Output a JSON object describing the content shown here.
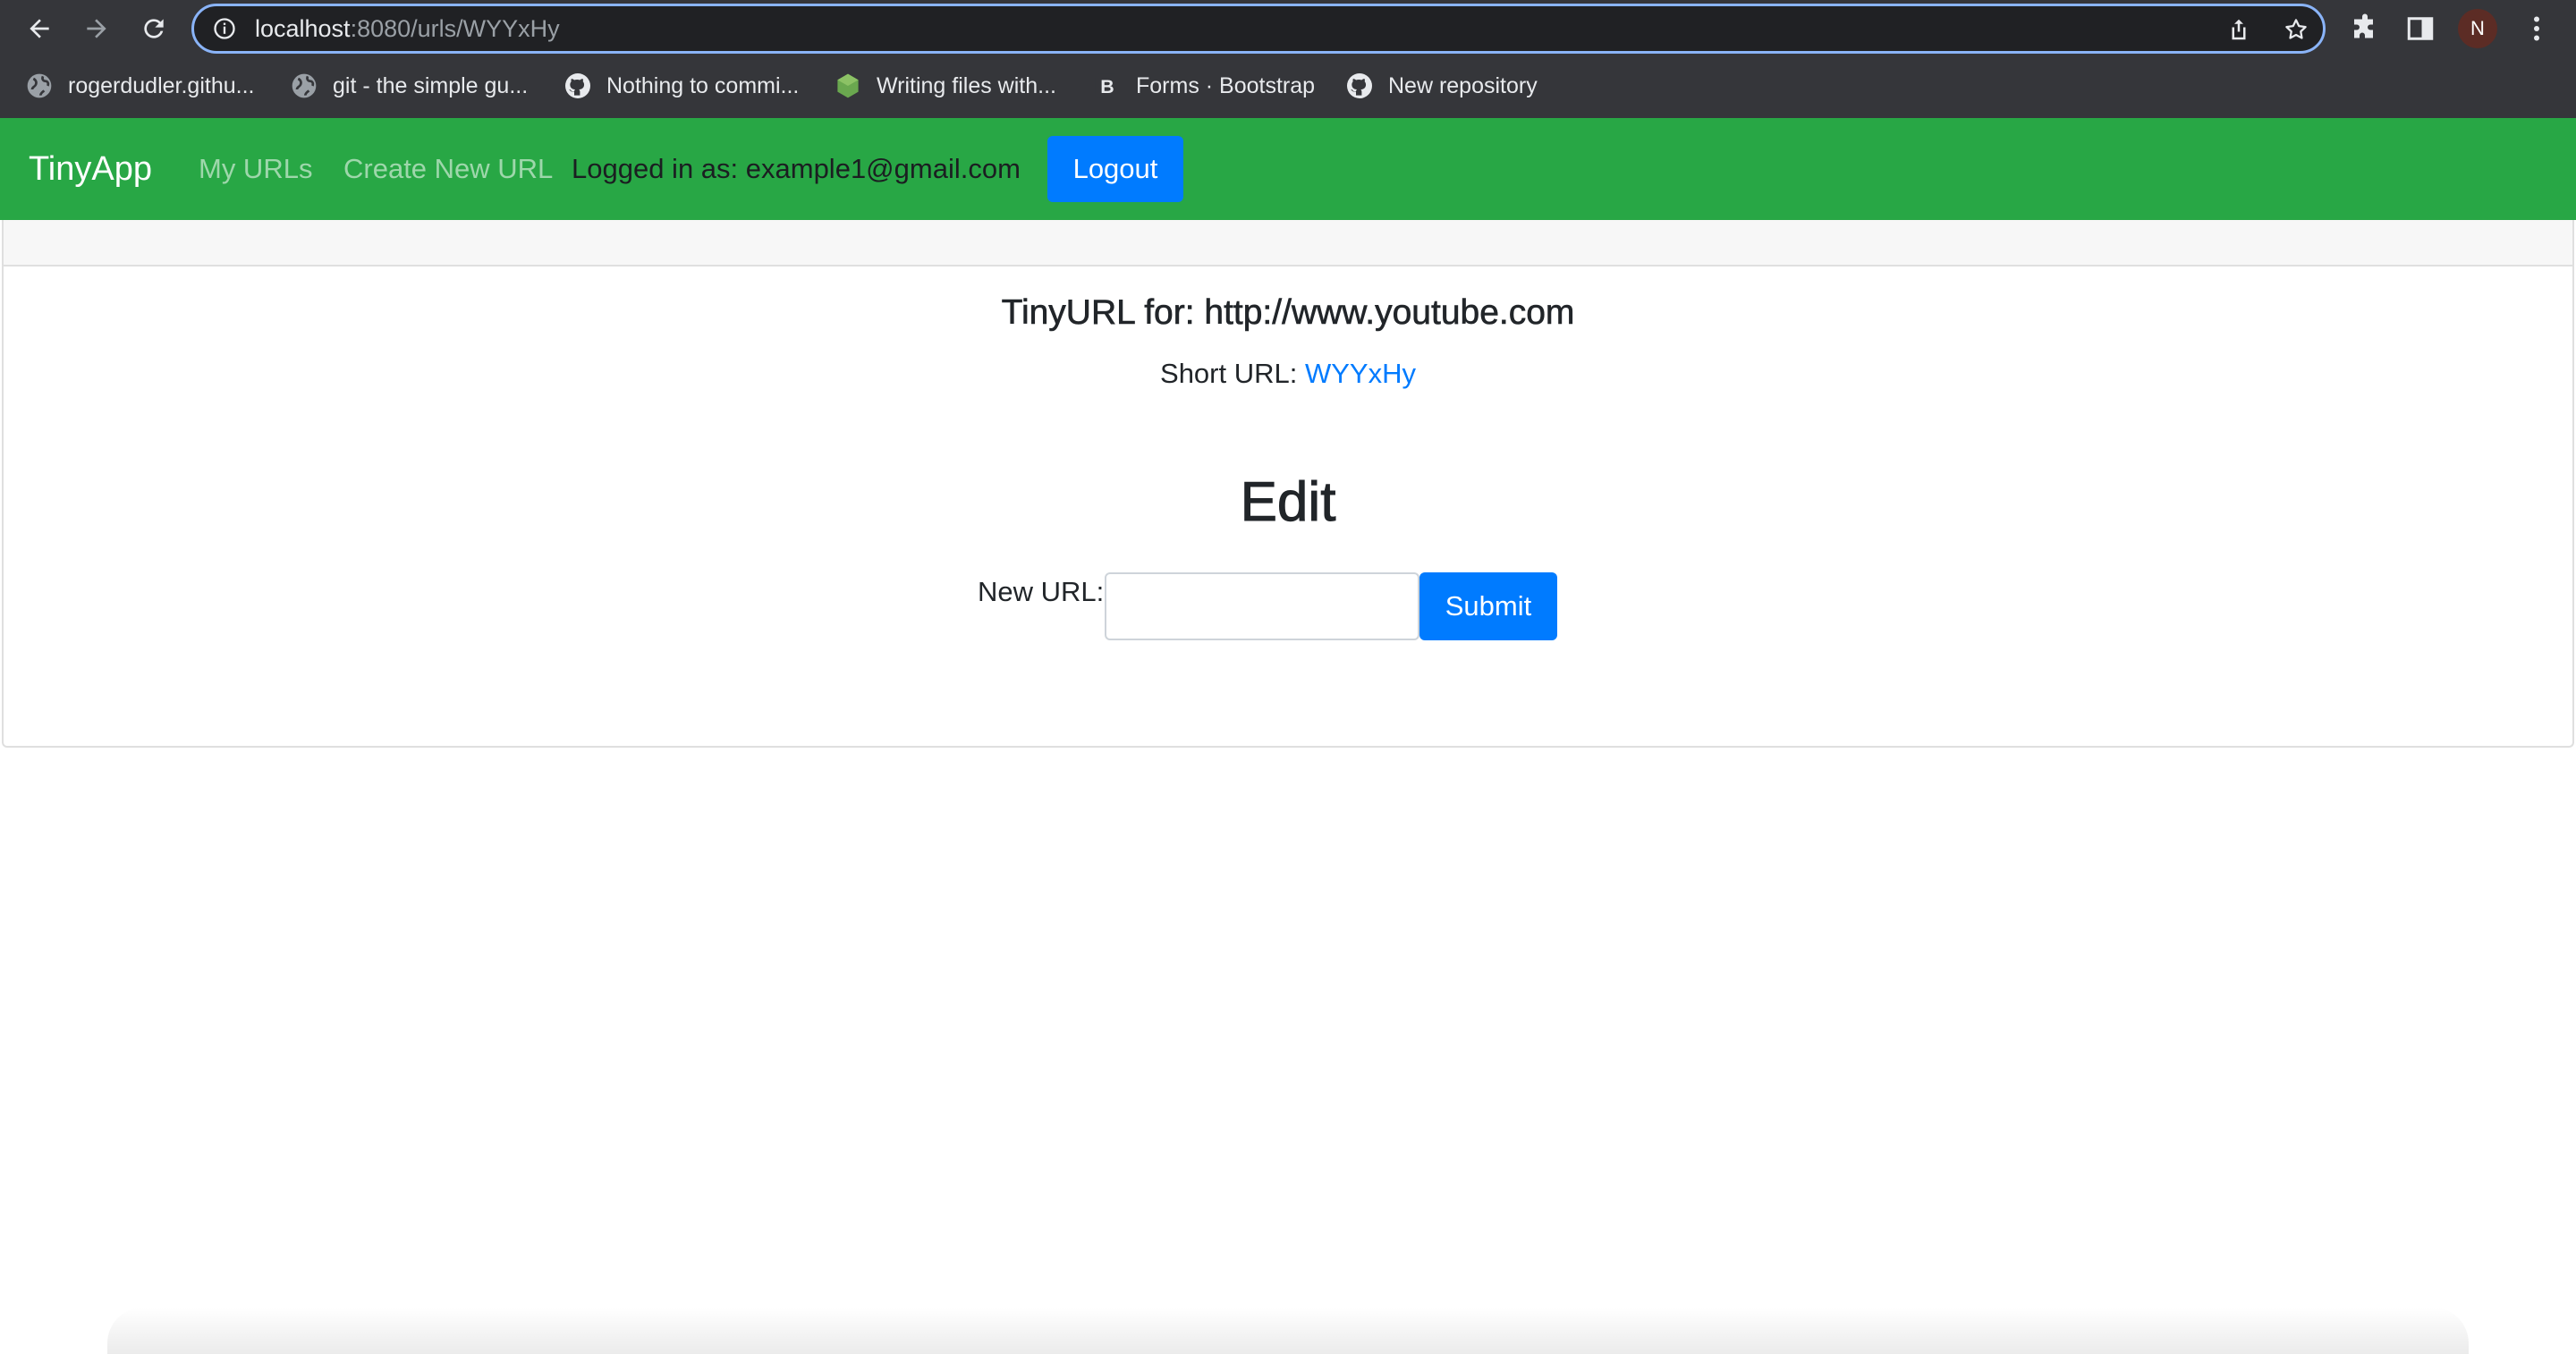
{
  "browser": {
    "url_host": "localhost",
    "url_path": ":8080/urls/WYYxHy",
    "profile_initial": "N",
    "bookmarks": [
      {
        "label": "rogerdudler.githu...",
        "icon": "globe-icon"
      },
      {
        "label": "git - the simple gu...",
        "icon": "globe-icon"
      },
      {
        "label": "Nothing to commi...",
        "icon": "github-icon"
      },
      {
        "label": "Writing files with...",
        "icon": "nodejs-icon"
      },
      {
        "label": "Forms · Bootstrap",
        "icon": "bootstrap-icon"
      },
      {
        "label": "New repository",
        "icon": "github-icon"
      }
    ]
  },
  "navbar": {
    "brand": "TinyApp",
    "my_urls": "My URLs",
    "create_new": "Create New URL",
    "logged_in": "Logged in as: example1@gmail.com",
    "logout": "Logout"
  },
  "card": {
    "title": "TinyURL for: http://www.youtube.com",
    "short_url_label": "Short URL: ",
    "short_url_value": "WYYxHy",
    "edit_heading": "Edit",
    "new_url_label": "New URL:",
    "new_url_value": "",
    "submit": "Submit"
  },
  "colors": {
    "navbar_bg": "#28a745",
    "primary": "#007bff",
    "chrome_bg": "#35363a"
  }
}
